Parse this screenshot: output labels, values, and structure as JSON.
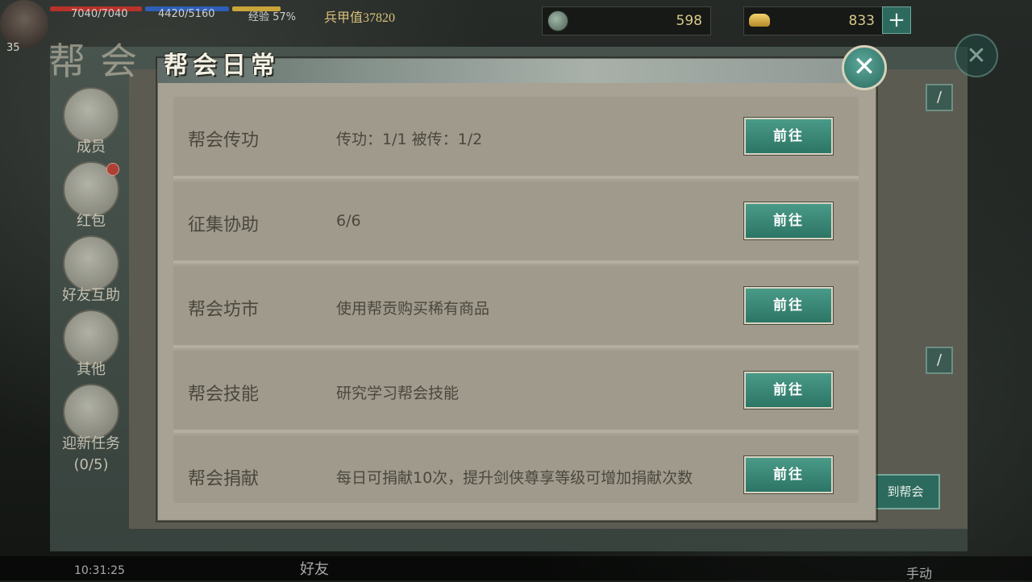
{
  "hud": {
    "hp": "7040/7040",
    "mp": "4420/5160",
    "exp": "经验 57%",
    "level": "35",
    "power": "兵甲值37820",
    "currency1": "598",
    "currency2": "833",
    "time": "10:31:25",
    "friend": "好友",
    "manual": "手动"
  },
  "guild_bg": {
    "title": "帮会",
    "side_items": [
      {
        "label": "成员"
      },
      {
        "label": "红包"
      },
      {
        "label": "好友互助"
      },
      {
        "label": "其他"
      },
      {
        "label": "迎新任务"
      },
      {
        "label": "(0/5)"
      }
    ],
    "goto_label": "到帮会"
  },
  "dialog": {
    "title": "帮会日常",
    "close_icon": "close-icon",
    "go_label": "前往",
    "rows": [
      {
        "name": "帮会传功",
        "desc": "传功：1/1 被传：1/2"
      },
      {
        "name": "征集协助",
        "desc": "6/6"
      },
      {
        "name": "帮会坊市",
        "desc": "使用帮贡购买稀有商品"
      },
      {
        "name": "帮会技能",
        "desc": "研究学习帮会技能"
      },
      {
        "name": "帮会捐献",
        "desc": "每日可捐献10次，提升剑侠尊享等级可增加捐献次数"
      }
    ]
  }
}
